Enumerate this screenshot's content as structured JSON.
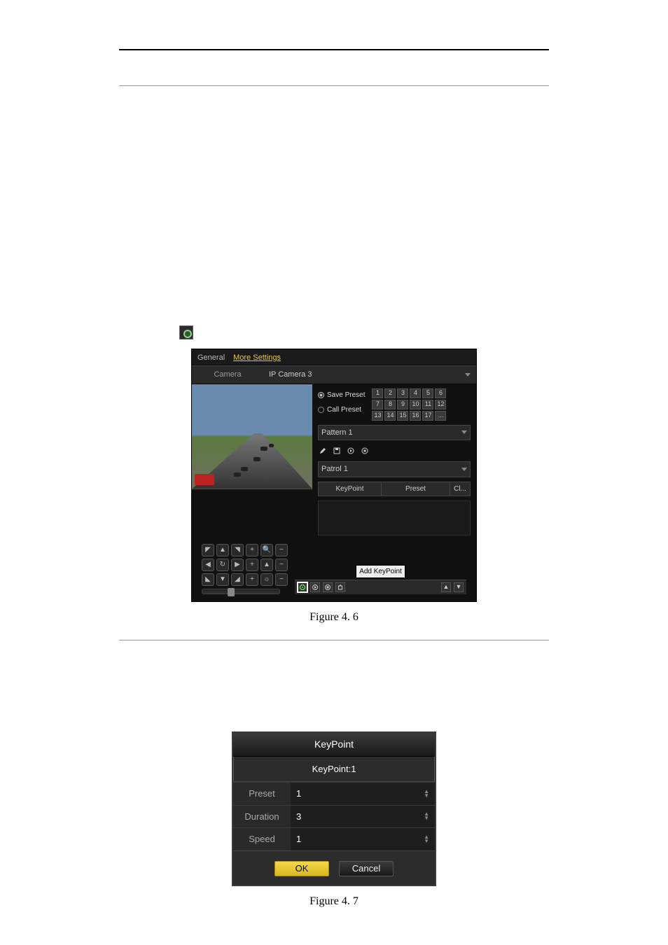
{
  "captions": {
    "fig46": "Figure 4. 6",
    "fig47": "Figure 4. 7"
  },
  "ptz": {
    "tabs": {
      "general": "General",
      "more": "More Settings"
    },
    "cameraLabel": "Camera",
    "cameraValue": "IP Camera 3",
    "savePreset": "Save Preset",
    "callPreset": "Call Preset",
    "presetNumbers": [
      "1",
      "2",
      "3",
      "4",
      "5",
      "6",
      "7",
      "8",
      "9",
      "10",
      "11",
      "12",
      "13",
      "14",
      "15",
      "16",
      "17",
      "..."
    ],
    "pattern": "Pattern 1",
    "patrol": "Patrol 1",
    "kpHeader": {
      "c1": "KeyPoint",
      "c2": "Preset",
      "c3": "Cl..."
    },
    "addKeyPoint": "Add KeyPoint",
    "dpadGlyphs": [
      "◤",
      "▲",
      "◥",
      "+",
      "🔍",
      "−",
      "◀",
      "↻",
      "▶",
      "+",
      "▲",
      "−",
      "◣",
      "▼",
      "◢",
      "+",
      "☼",
      "−"
    ]
  },
  "kpDialog": {
    "title": "KeyPoint",
    "subtitle": "KeyPoint:1",
    "fields": {
      "presetLabel": "Preset",
      "presetValue": "1",
      "durationLabel": "Duration",
      "durationValue": "3",
      "speedLabel": "Speed",
      "speedValue": "1"
    },
    "ok": "OK",
    "cancel": "Cancel"
  }
}
